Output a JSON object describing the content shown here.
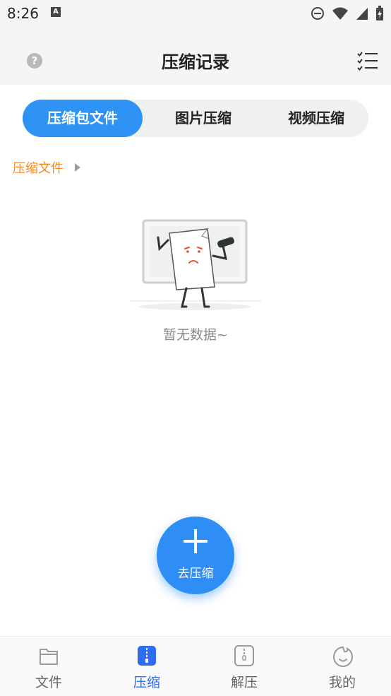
{
  "status_bar": {
    "time": "8:26",
    "notification_icon": "a-letter-icon",
    "icons": [
      "do-not-disturb-icon",
      "wifi-icon",
      "signal-icon",
      "battery-charging-icon"
    ]
  },
  "header": {
    "title": "压缩记录",
    "left_icon": "help-icon",
    "right_icon": "checklist-icon"
  },
  "tabs": [
    {
      "label": "压缩包文件",
      "active": true
    },
    {
      "label": "图片压缩",
      "active": false
    },
    {
      "label": "视频压缩",
      "active": false
    }
  ],
  "breadcrumb": {
    "label": "压缩文件"
  },
  "empty_state": {
    "text": "暂无数据~",
    "illustration": "sad-document-illustration"
  },
  "fab": {
    "label": "去压缩",
    "icon": "plus-icon"
  },
  "bottom_nav": [
    {
      "label": "文件",
      "icon": "folder-icon",
      "active": false
    },
    {
      "label": "压缩",
      "icon": "zip-icon",
      "active": true
    },
    {
      "label": "解压",
      "icon": "unzip-icon",
      "active": false
    },
    {
      "label": "我的",
      "icon": "profile-face-icon",
      "active": false
    }
  ],
  "colors": {
    "accent": "#2e93f5",
    "nav_active": "#2e6cf0",
    "breadcrumb": "#f48a1f",
    "background": "#ffffff"
  }
}
